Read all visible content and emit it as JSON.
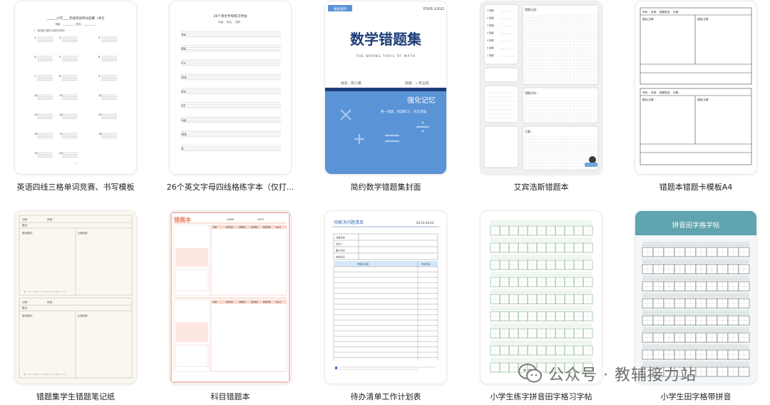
{
  "cards": [
    {
      "title": "英语四线三格单词竞赛、书写模板",
      "thumb": {
        "heading": "______小学____年级英语单词竞赛（书写",
        "fields": "班级：__________  姓名：__________",
        "instruction": "一、在四线三格中认真抄写单词",
        "numbers": [
          "1.",
          "2.",
          "3.",
          "4.",
          "5.",
          "6.",
          "7.",
          "8.",
          "9.",
          "10.",
          "11.",
          "12.",
          "13.",
          "14.",
          "15.",
          "16.",
          "17.",
          "18.",
          "19.",
          "20."
        ]
      }
    },
    {
      "title": "26个英文字母四线格练字本（仅打...",
      "thumb": {
        "heading": "26个英文字母练习字帖",
        "fields": "班级：        姓名：        日期：",
        "letters": [
          "Aa",
          "Bb",
          "Cc",
          "Dd",
          "Ee",
          "Ff",
          "Gg",
          "Hh",
          "Ii"
        ]
      }
    },
    {
      "title": "简约数学错题集封面",
      "thumb": {
        "badge": "相关资料",
        "logo": "YOUR LOGO",
        "main": "数学错题集",
        "sub": "THE WRONG TOPIC OF MATH",
        "name": "姓名：陈小美",
        "grade": "班级：一年五班",
        "slogan": "强化记忆",
        "motto": "整一道题、梳理练习、夯实基础"
      }
    },
    {
      "title": "艾宾浩斯错题本",
      "thumb": {
        "left_labels": [
          "1 周期",
          "2 周期",
          "3 周期",
          "4 周期",
          "5 周期",
          "6 周期",
          "7 周期"
        ],
        "right_labels": [
          "错题记录：",
          "错题分析：",
          "正解："
        ]
      }
    },
    {
      "title": "错题本错题卡模板A4",
      "thumb": {
        "row1": "学科：   来源：   错题类型：   日期：",
        "left": "题目/正解",
        "right": "错因/正解"
      }
    },
    {
      "title": "错题集学生错题笔记纸",
      "thumb": {
        "labels": [
          "日期：",
          "来源：",
          "题目：",
          "错误原因：",
          "正确答案：",
          "难度："
        ]
      }
    },
    {
      "title": "科目错题本",
      "thumb": {
        "header": "错题本",
        "name": "NAME",
        "date": "DATE",
        "cols": [
          "题目",
          "错误答案",
          "正确答案",
          "错误原因",
          "解题思路",
          "知识点"
        ]
      }
    },
    {
      "title": "待办清单工作计划表",
      "thumb": {
        "header": "待解决问题清单",
        "date": "04.15-04.22",
        "rows": [
          "问题名称",
          "负责人",
          "截止时间",
          "完成情况"
        ],
        "cols": [
          "待解决问题",
          "完成情况"
        ]
      }
    },
    {
      "title": "小学生练字拼音田字格习字帖",
      "thumb": {}
    },
    {
      "title": "小学生田字格带拼音",
      "thumb": {
        "banner": "拼音田字格字帖"
      }
    }
  ],
  "watermark": {
    "text": "公众号 · 教辅接力站"
  },
  "colors": {
    "blue": "#5a93d6",
    "navy": "#1e3c78",
    "teal": "#5fa4ae",
    "salmon": "#e8826a",
    "green": "#5a9b5a"
  }
}
